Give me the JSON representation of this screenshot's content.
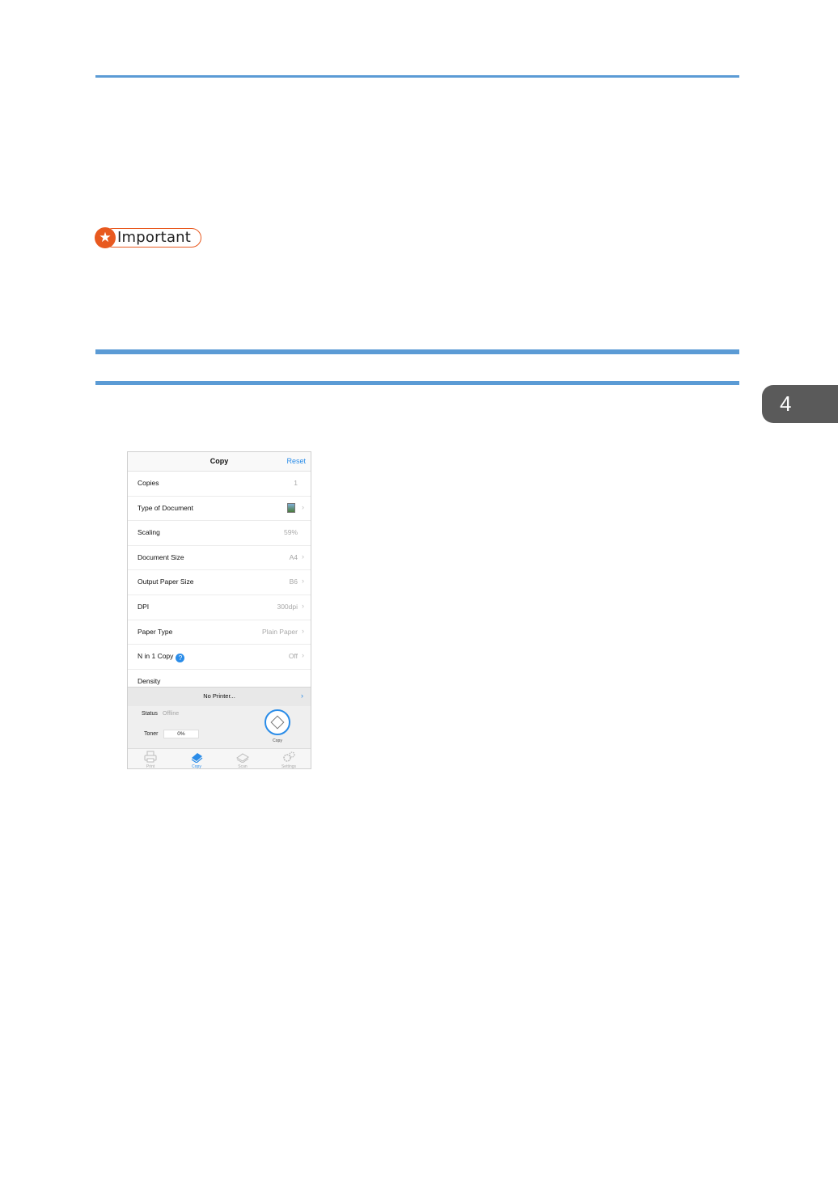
{
  "chapter_tab": "4",
  "important_label": "Important",
  "app": {
    "nav_title": "Copy",
    "nav_reset": "Reset",
    "settings": [
      {
        "label": "Copies",
        "value": "1"
      },
      {
        "label": "Type of Document",
        "value": ""
      },
      {
        "label": "Scaling",
        "value": "59%"
      },
      {
        "label": "Document Size",
        "value": "A4"
      },
      {
        "label": "Output Paper Size",
        "value": "B6"
      },
      {
        "label": "DPI",
        "value": "300dpi"
      },
      {
        "label": "Paper Type",
        "value": "Plain Paper"
      },
      {
        "label": "N in 1 Copy",
        "value": "Off"
      },
      {
        "label": "Density",
        "value": ""
      }
    ],
    "printer_label": "No Printer...",
    "status_label": "Status",
    "status_value": "Offline",
    "toner_label": "Toner",
    "toner_value": "0%",
    "copy_button_label": "Copy",
    "tabs": [
      {
        "label": "Print",
        "icon": "printer-icon"
      },
      {
        "label": "Copy",
        "icon": "copy-icon"
      },
      {
        "label": "Scan",
        "icon": "scanner-icon"
      },
      {
        "label": "Settings",
        "icon": "gears-icon"
      }
    ]
  },
  "colors": {
    "accent": "#5b9bd5",
    "important": "#e8591f",
    "ios_blue": "#2a8ce8"
  }
}
